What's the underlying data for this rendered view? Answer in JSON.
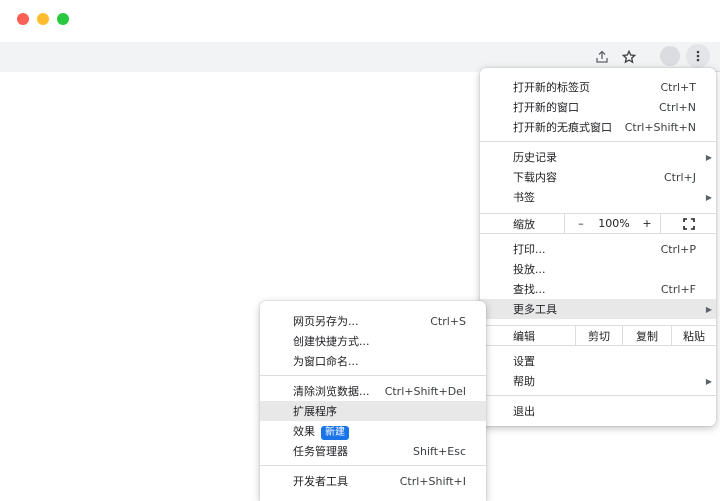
{
  "window": {
    "traffic_lights": [
      "close",
      "minimize",
      "maximize"
    ]
  },
  "toolbar": {
    "share_icon": "share-icon",
    "star_icon": "star-icon",
    "menu_icon": "more-vert-icon"
  },
  "main_menu": {
    "group1": [
      {
        "label": "打开新的标签页",
        "shortcut": "Ctrl+T"
      },
      {
        "label": "打开新的窗口",
        "shortcut": "Ctrl+N"
      },
      {
        "label": "打开新的无痕式窗口",
        "shortcut": "Ctrl+Shift+N"
      }
    ],
    "group2": [
      {
        "label": "历史记录",
        "shortcut": ""
      },
      {
        "label": "下载内容",
        "shortcut": "Ctrl+J"
      },
      {
        "label": "书签",
        "shortcut": ""
      }
    ],
    "zoom": {
      "label": "缩放",
      "minus": "–",
      "value": "100%",
      "plus": "+"
    },
    "group3": [
      {
        "label": "打印...",
        "shortcut": "Ctrl+P"
      },
      {
        "label": "投放...",
        "shortcut": ""
      },
      {
        "label": "查找...",
        "shortcut": "Ctrl+F"
      },
      {
        "label": "更多工具",
        "shortcut": ""
      }
    ],
    "edit": {
      "label": "编辑",
      "cut": "剪切",
      "copy": "复制",
      "paste": "粘贴"
    },
    "group4": [
      {
        "label": "设置",
        "shortcut": ""
      },
      {
        "label": "帮助",
        "shortcut": ""
      }
    ],
    "exit": {
      "label": "退出"
    }
  },
  "sub_menu": {
    "group1": [
      {
        "label": "网页另存为...",
        "shortcut": "Ctrl+S"
      },
      {
        "label": "创建快捷方式...",
        "shortcut": ""
      },
      {
        "label": "为窗口命名...",
        "shortcut": ""
      }
    ],
    "group2": [
      {
        "label": "清除浏览数据...",
        "shortcut": "Ctrl+Shift+Del"
      },
      {
        "label": "扩展程序",
        "shortcut": ""
      },
      {
        "label": "效果",
        "badge": "新建",
        "shortcut": ""
      },
      {
        "label": "任务管理器",
        "shortcut": "Shift+Esc"
      }
    ],
    "group3": [
      {
        "label": "开发者工具",
        "shortcut": "Ctrl+Shift+I"
      }
    ]
  },
  "colors": {
    "accent": "#1a73e8",
    "highlight": "#e8e8e9",
    "toolbar": "#f1f3f4"
  }
}
